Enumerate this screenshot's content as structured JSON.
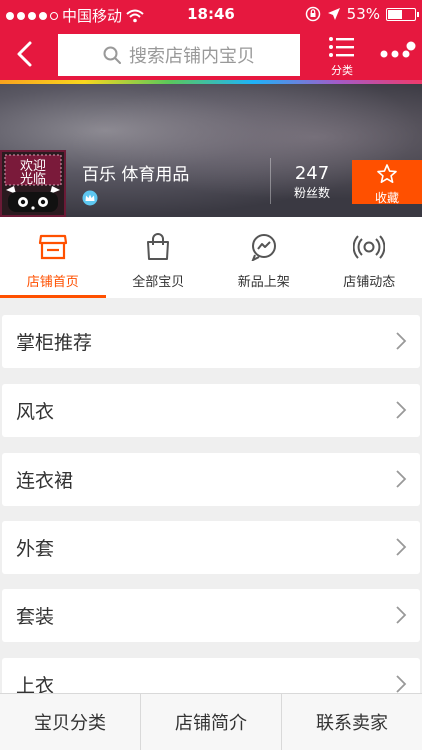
{
  "status_bar": {
    "carrier": "中国移动",
    "time": "18:46",
    "battery_percent": "53%",
    "battery_level": 0.53
  },
  "nav": {
    "search_placeholder": "搜索店铺内宝贝",
    "menu_label": "分类",
    "icons": [
      "back-arrow-icon",
      "search-icon",
      "list-icon",
      "more-icon"
    ]
  },
  "shop": {
    "logo_text": "欢迎光临",
    "name": "百乐 体育用品",
    "fans_count": "247",
    "fans_label": "粉丝数",
    "favorite_label": "收藏"
  },
  "tabs": [
    {
      "label": "店铺首页",
      "icon": "store-icon",
      "active": true
    },
    {
      "label": "全部宝贝",
      "icon": "bag-icon",
      "active": false
    },
    {
      "label": "新品上架",
      "icon": "lightning-chat-icon",
      "active": false
    },
    {
      "label": "店铺动态",
      "icon": "broadcast-icon",
      "active": false
    }
  ],
  "categories": [
    "掌柜推荐",
    "风衣",
    "连衣裙",
    "外套",
    "套装",
    "上衣"
  ],
  "bottom_bar": [
    "宝贝分类",
    "店铺简介",
    "联系卖家"
  ],
  "colors": {
    "header_red": "#e6183f",
    "accent_orange": "#ff5000"
  }
}
